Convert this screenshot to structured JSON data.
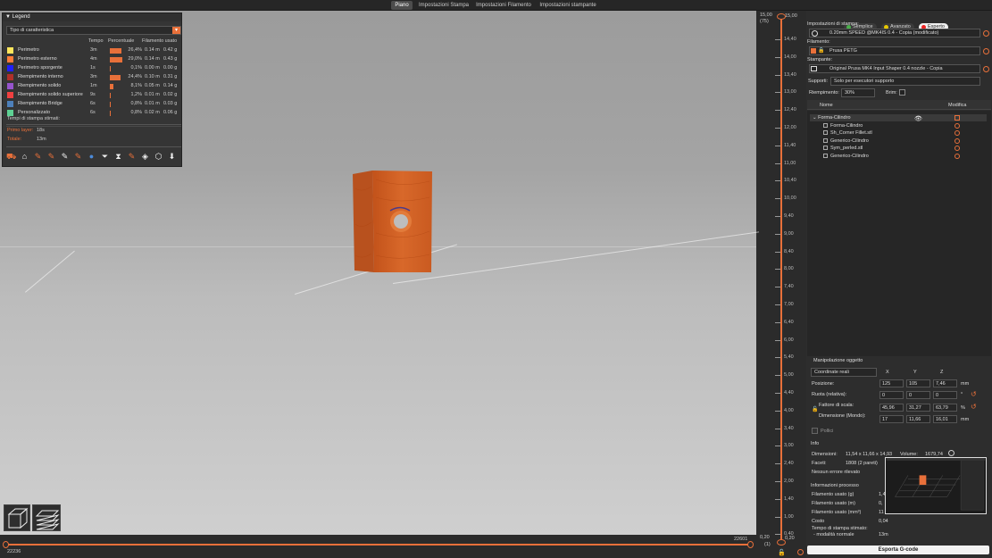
{
  "tabs": [
    {
      "label": "Piano",
      "active": true
    },
    {
      "label": "Impostazioni Stampa"
    },
    {
      "label": "Impostazioni Filamento"
    },
    {
      "label": "Impostazioni stampante"
    }
  ],
  "legend": {
    "title": "Legend",
    "feature_type": "Tipo di caratteristica",
    "columns": {
      "time": "Tempo",
      "percent": "Percentuale",
      "filament": "Filamento usato"
    },
    "rows": [
      {
        "name": "Perimetro",
        "color": "#ffe65c",
        "time": "3m",
        "pct": "26,4%",
        "fill": 26.4,
        "m": "0.14 m",
        "g": "0.42 g"
      },
      {
        "name": "Perimetro esterno",
        "color": "#ff7d38",
        "time": "4m",
        "pct": "29,0%",
        "fill": 29.0,
        "m": "0.14 m",
        "g": "0.43 g"
      },
      {
        "name": "Perimetro sporgente",
        "color": "#1f1fff",
        "time": "1s",
        "pct": "0,1%",
        "fill": 0.1,
        "m": "0.00 m",
        "g": "0.00 g"
      },
      {
        "name": "Riempimento interno",
        "color": "#b03029",
        "time": "3m",
        "pct": "24,4%",
        "fill": 24.4,
        "m": "0.10 m",
        "g": "0.31 g"
      },
      {
        "name": "Riempimento solido",
        "color": "#9654cc",
        "time": "1m",
        "pct": "8,1%",
        "fill": 8.1,
        "m": "0.05 m",
        "g": "0.14 g"
      },
      {
        "name": "Riempimento solido superiore",
        "color": "#f04040",
        "time": "9s",
        "pct": "1,2%",
        "fill": 1.2,
        "m": "0.01 m",
        "g": "0.02 g"
      },
      {
        "name": "Riempimento Bridge",
        "color": "#4d80ba",
        "time": "6s",
        "pct": "0,8%",
        "fill": 0.8,
        "m": "0.01 m",
        "g": "0.03 g"
      },
      {
        "name": "Personalizzato",
        "color": "#5ed194",
        "time": "6s",
        "pct": "0,8%",
        "fill": 0.8,
        "m": "0.02 m",
        "g": "0.06 g"
      }
    ],
    "estimated_label": "Tempi di stampa stimati:",
    "first_layer_label": "Primo layer:",
    "first_layer_value": "18s",
    "total_label": "Totale:",
    "total_value": "13m"
  },
  "vertical_slider": {
    "top_value": "15,00",
    "top_layer": "(75)",
    "ticks": [
      "14,40",
      "14,00",
      "13,40",
      "13,00",
      "12,40",
      "12,00",
      "11,40",
      "11,00",
      "10,40",
      "10,00",
      "9,40",
      "9,00",
      "8,40",
      "8,00",
      "7,40",
      "7,00",
      "6,40",
      "6,00",
      "5,40",
      "5,00",
      "4,40",
      "4,00",
      "3,40",
      "3,00",
      "2,40",
      "2,00",
      "1,40",
      "1,00",
      "0,40"
    ],
    "bottom_value": "0,20",
    "bottom_layer": "(1)"
  },
  "horizontal_slider": {
    "left": "22236",
    "right": "22601"
  },
  "panel": {
    "modes": [
      {
        "label": "Semplice",
        "color": "#49b04a"
      },
      {
        "label": "Avanzato",
        "color": "#e6c800"
      },
      {
        "label": "Esperto",
        "color": "#e22",
        "active": true
      }
    ],
    "print_settings_label": "Impostazioni di stampa:",
    "print_settings_value": "0.20mm SPEED @MK4IS 0.4 - Copia (modificato)",
    "filament_label": "Filamento:",
    "filament_value": "Prusa PETG",
    "printer_label": "Stampante:",
    "printer_value": "Original Prusa MK4 Input Shaper 0.4 nozzle - Copia",
    "supports_label": "Supporti:",
    "supports_value": "Solo per esecutori supporto",
    "infill_label": "Riempimento:",
    "infill_value": "30%",
    "brim_label": "Brim:",
    "col_name": "Nome",
    "col_edit": "Modifica",
    "tree": [
      "Forma-Cilindro",
      "Forma-Cilindro",
      "Sh_Corner Fillet.stl",
      "Generico-Cilindro",
      "Sym_perled.stl",
      "Generico-Cilindro"
    ],
    "manip_title": "Manipolazione oggetto",
    "coord_value": "Coordinate reali",
    "axes": [
      "X",
      "Y",
      "Z"
    ],
    "position_label": "Posizione:",
    "position": [
      "125",
      "105",
      "7,46"
    ],
    "position_unit": "mm",
    "rotate_label": "Ruota (relativa):",
    "rotate": [
      "0",
      "0",
      "0"
    ],
    "rotate_unit": "°",
    "scale_label": "Fattore di scala:",
    "scale": [
      "45,96",
      "31,27",
      "63,79"
    ],
    "scale_unit": "%",
    "size_label": "Dimensione (Mondo):",
    "size": [
      "17",
      "11,66",
      "16,01"
    ],
    "size_unit": "mm",
    "inches_label": "Pollici",
    "info_title": "Info",
    "dim_label": "Dimensioni:",
    "dim_value": "11,54 x 11,66 x 14,93",
    "vol_label": "Volume:",
    "vol_value": "1679,74",
    "facets_label": "Faceti:",
    "facets_value": "1808 (2 pareti)",
    "errors_value": "Nessun errore rilevato",
    "proc_title": "Informazioni processo",
    "proc_rows": [
      {
        "label": "Filamento usato (g)",
        "value": "1,4"
      },
      {
        "label": "Filamento usato (m)",
        "value": "0,"
      },
      {
        "label": "Filamento usato (mm³)",
        "value": "11"
      },
      {
        "label": "Costo",
        "value": "0,04"
      }
    ],
    "time_label": "Tempo di stampa stimato:",
    "time_mode_label": "- modalità normale",
    "time_value": "13m",
    "export_label": "Esporta G-code"
  }
}
